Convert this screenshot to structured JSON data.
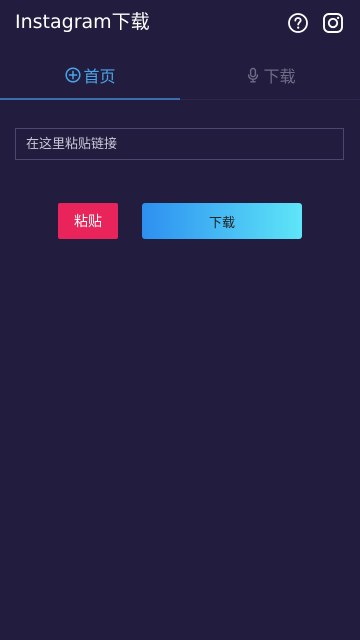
{
  "app_bar": {
    "title": "Instagram下载",
    "icons": [
      "help-circle-icon",
      "instagram-icon"
    ]
  },
  "tabs": [
    {
      "label": "首页",
      "icon": "plus-circle-icon",
      "selected": true
    },
    {
      "label": "下载",
      "icon": "microphone-icon",
      "selected": false
    }
  ],
  "link_input": {
    "value": "",
    "placeholder": "在这里粘贴链接"
  },
  "actions": {
    "paste_label": "粘贴",
    "download_label": "下载"
  },
  "colors": {
    "background": "#221d3e",
    "tab_active": "#4aa3e8",
    "tab_inactive": "#6f6c86",
    "paste_button": "#e8245a",
    "download_gradient_start": "#2d8ff0",
    "download_gradient_end": "#5ee6f8"
  }
}
